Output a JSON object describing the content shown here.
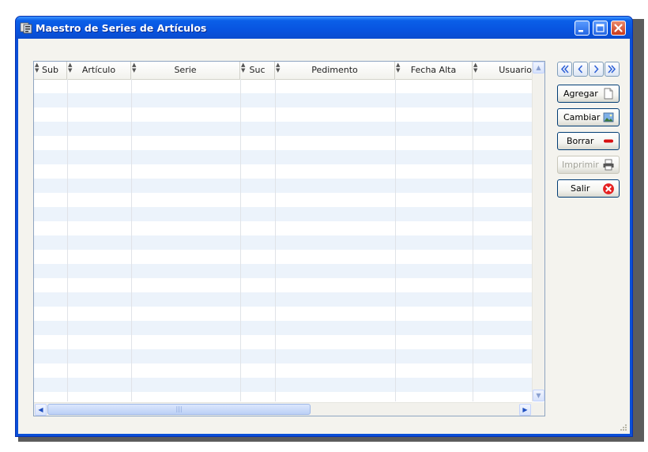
{
  "window": {
    "title": "Maestro de Series de Artículos"
  },
  "grid": {
    "columns": [
      {
        "key": "sub",
        "label": "Sub"
      },
      {
        "key": "articulo",
        "label": "Artículo"
      },
      {
        "key": "serie",
        "label": "Serie"
      },
      {
        "key": "suc",
        "label": "Suc"
      },
      {
        "key": "pedimento",
        "label": "Pedimento"
      },
      {
        "key": "fecha_alta",
        "label": "Fecha Alta"
      },
      {
        "key": "usuario",
        "label": "Usuario"
      }
    ],
    "rows": []
  },
  "navigation": {
    "first_icon": "chevron-double-left-icon",
    "prev_icon": "chevron-left-icon",
    "next_icon": "chevron-right-icon",
    "last_icon": "chevron-double-right-icon"
  },
  "actions": {
    "agregar": {
      "label": "Agregar",
      "icon": "new-document-icon",
      "enabled": true
    },
    "cambiar": {
      "label": "Cambiar",
      "icon": "picture-icon",
      "enabled": true
    },
    "borrar": {
      "label": "Borrar",
      "icon": "minus-icon",
      "enabled": true
    },
    "imprimir": {
      "label": "Imprimir",
      "icon": "printer-icon",
      "enabled": false
    },
    "salir": {
      "label": "Salir",
      "icon": "close-circle-icon",
      "enabled": true
    }
  },
  "colors": {
    "title_bar": "#0a5fe8",
    "row_alt": "#ecf3fb",
    "close_button": "#cc3a1a",
    "exit_icon": "#e52020",
    "delete_icon": "#d81010"
  }
}
